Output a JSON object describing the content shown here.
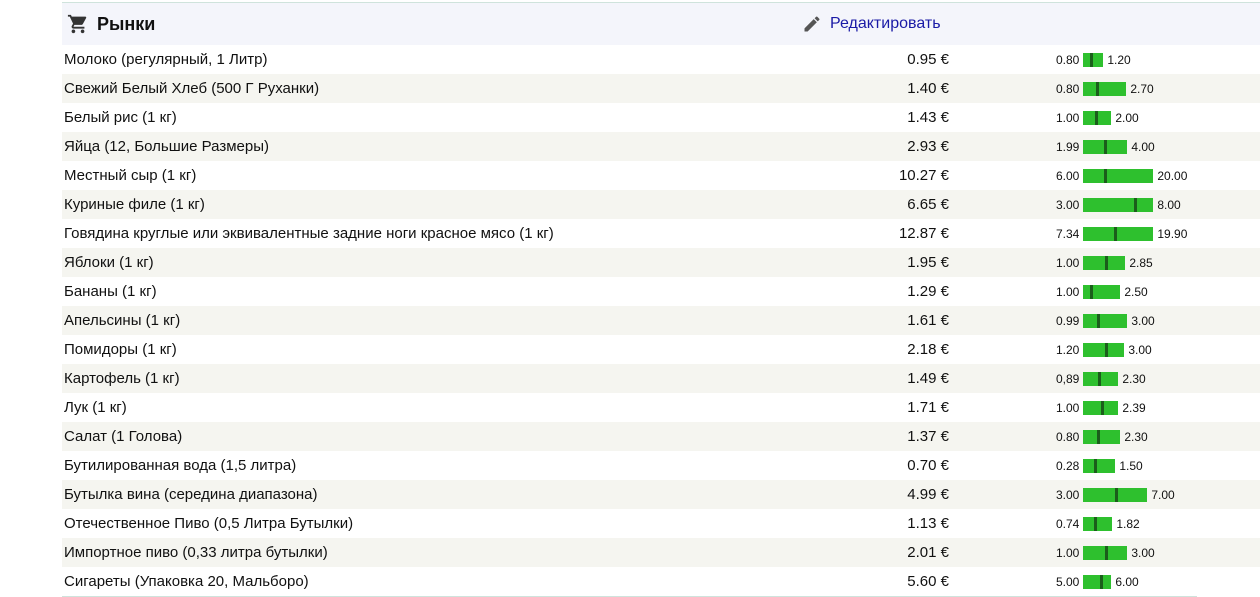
{
  "section": {
    "title": "Рынки",
    "icon": "shopping-cart-icon",
    "edit_label": "Редактировать",
    "edit_icon": "pencil-icon"
  },
  "colors": {
    "bar": "#2ec02e",
    "bar_marker": "#1b5e1b",
    "link": "#1a1aa6",
    "row_alt": "#f5f5f0"
  },
  "items": [
    {
      "name": "Молоко (регулярный, 1 Литр)",
      "price": "0.95 €",
      "min": "0.80",
      "max": "1.20"
    },
    {
      "name": "Свежий Белый Хлеб (500 Г Руханки)",
      "price": "1.40 €",
      "min": "0.80",
      "max": "2.70"
    },
    {
      "name": "Белый рис (1 кг)",
      "price": "1.43 €",
      "min": "1.00",
      "max": "2.00"
    },
    {
      "name": "Яйца (12, Большие Размеры)",
      "price": "2.93 €",
      "min": "1.99",
      "max": "4.00"
    },
    {
      "name": "Местный сыр (1 кг)",
      "price": "10.27 €",
      "min": "6.00",
      "max": "20.00"
    },
    {
      "name": "Куриные филе (1 кг)",
      "price": "6.65 €",
      "min": "3.00",
      "max": "8.00"
    },
    {
      "name": "Говядина круглые или эквивалентные задние ноги красное мясо (1 кг)",
      "price": "12.87 €",
      "min": "7.34",
      "max": "19.90"
    },
    {
      "name": "Яблоки (1 кг)",
      "price": "1.95 €",
      "min": "1.00",
      "max": "2.85"
    },
    {
      "name": "Бананы (1 кг)",
      "price": "1.29 €",
      "min": "1.00",
      "max": "2.50"
    },
    {
      "name": "Апельсины (1 кг)",
      "price": "1.61 €",
      "min": "0.99",
      "max": "3.00"
    },
    {
      "name": "Помидоры (1 кг)",
      "price": "2.18 €",
      "min": "1.20",
      "max": "3.00"
    },
    {
      "name": "Картофель (1 кг)",
      "price": "1.49 €",
      "min": "0,89",
      "max": "2.30"
    },
    {
      "name": "Лук (1 кг)",
      "price": "1.71 €",
      "min": "1.00",
      "max": "2.39"
    },
    {
      "name": "Салат (1 Голова)",
      "price": "1.37 €",
      "min": "0.80",
      "max": "2.30"
    },
    {
      "name": "Бутилированная вода (1,5 литра)",
      "price": "0.70 €",
      "min": "0.28",
      "max": "1.50"
    },
    {
      "name": "Бутылка вина (середина диапазона)",
      "price": "4.99 €",
      "min": "3.00",
      "max": "7.00"
    },
    {
      "name": "Отечественное Пиво (0,5 Литра Бутылки)",
      "price": "1.13 €",
      "min": "0.74",
      "max": "1.82"
    },
    {
      "name": "Импортное пиво (0,33 литра бутылки)",
      "price": "2.01 €",
      "min": "1.00",
      "max": "3.00"
    },
    {
      "name": "Сигареты (Упаковка 20, Мальборо)",
      "price": "5.60 €",
      "min": "5.00",
      "max": "6.00"
    }
  ]
}
